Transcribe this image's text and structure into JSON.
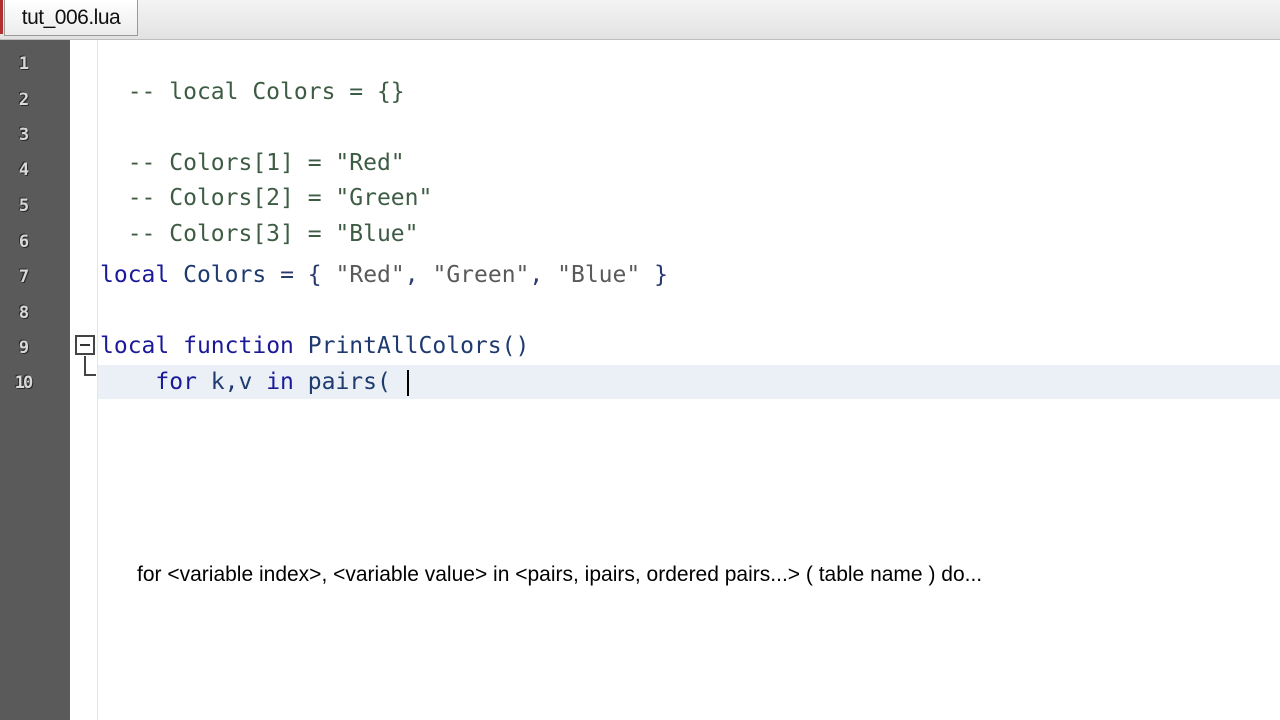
{
  "tab": {
    "filename": "tut_006.lua"
  },
  "gutter": {
    "line_numbers": [
      "1",
      "2",
      "3",
      "4",
      "5",
      "6",
      "7",
      "8",
      "9",
      "10"
    ]
  },
  "code": {
    "line1": {
      "comment": "-- local Colors = {}"
    },
    "line3": {
      "comment": "-- Colors[1] = \"Red\""
    },
    "line4": {
      "comment": "-- Colors[2] = \"Green\""
    },
    "line5": {
      "comment": "-- Colors[3] = \"Blue\""
    },
    "line7": {
      "kw_local": "local",
      "ident": "Colors",
      "eq": "=",
      "open": "{",
      "s1": "\"Red\"",
      "s2": "\"Green\"",
      "s3": "\"Blue\"",
      "close": "}"
    },
    "line9": {
      "kw_local": "local",
      "kw_function": "function",
      "name": "PrintAllColors()"
    },
    "line10": {
      "kw_for": "for",
      "vars": "k,v",
      "kw_in": "in",
      "call": "pairs("
    }
  },
  "hint": {
    "text": "for <variable index>, <variable value> in <pairs, ipairs, ordered pairs...> ( table name ) do..."
  },
  "colors": {
    "comment": "#3e5c44",
    "keyword": "#1a1a99",
    "current_line": "#eaf0f6",
    "gutter": "#5a5a5a"
  }
}
